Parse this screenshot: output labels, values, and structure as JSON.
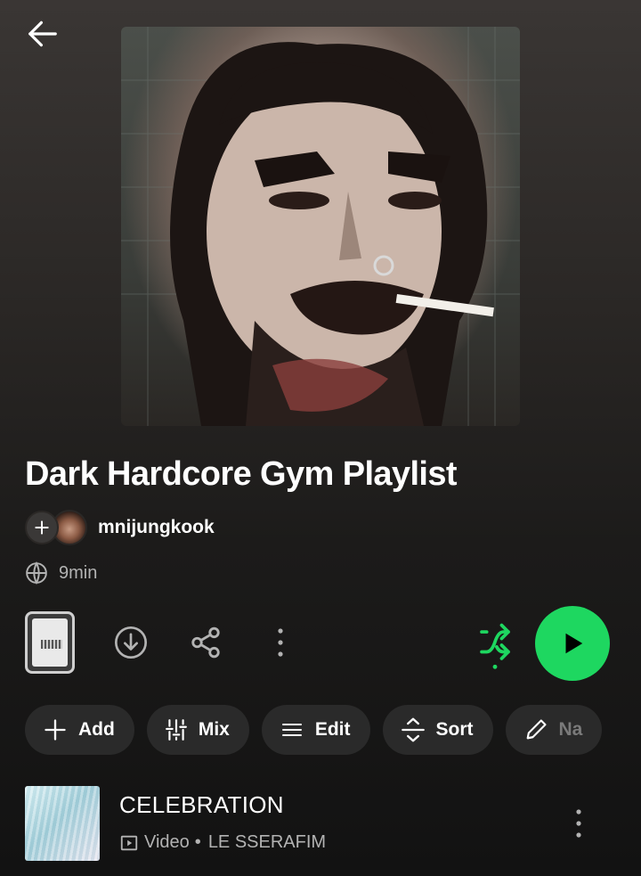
{
  "header": {
    "back_icon": "arrow-left-icon"
  },
  "playlist": {
    "cover_alt": "playlist-cover",
    "title": "Dark Hardcore Gym Playlist",
    "owner": "mnijungkook",
    "duration": "9min",
    "visibility_icon": "globe-icon"
  },
  "actions": {
    "download_icon": "download-icon",
    "share_icon": "share-icon",
    "more_icon": "more-vertical-icon",
    "shuffle_icon": "shuffle-icon",
    "play_icon": "play-icon"
  },
  "chips": [
    {
      "label": "Add",
      "icon": "plus-icon"
    },
    {
      "label": "Mix",
      "icon": "sliders-icon"
    },
    {
      "label": "Edit",
      "icon": "menu-lines-icon"
    },
    {
      "label": "Sort",
      "icon": "sort-icon"
    },
    {
      "label": "Na",
      "icon": "pencil-icon"
    }
  ],
  "tracks": [
    {
      "title": "CELEBRATION",
      "type": "Video",
      "separator": "•",
      "artist": "LE SSERAFIM"
    }
  ],
  "colors": {
    "accent": "#1ed760",
    "background": "#121212",
    "muted_text": "#b3b3b3",
    "chip_bg": "#2a2a2a"
  }
}
